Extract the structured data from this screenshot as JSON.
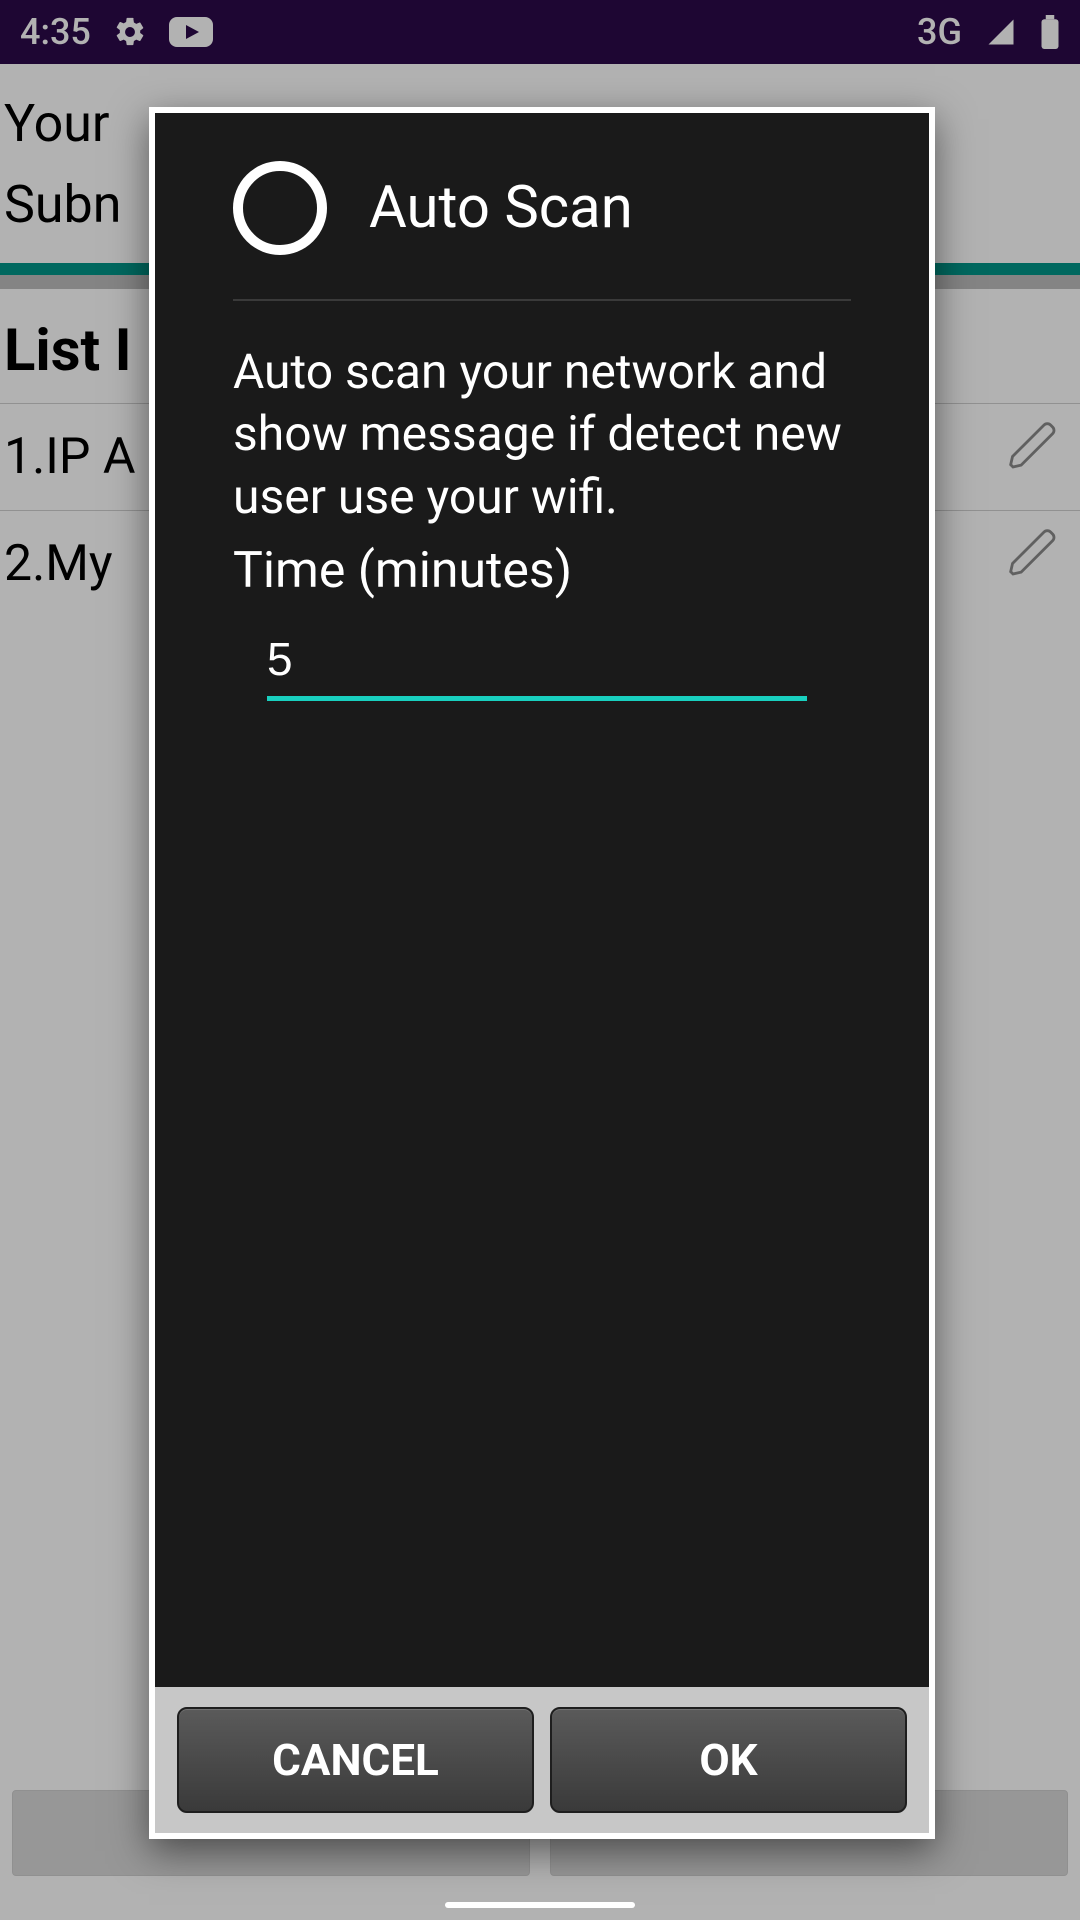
{
  "statusbar": {
    "time": "4:35",
    "network_label": "3G",
    "icons": {
      "settings": "settings-icon",
      "youtube": "youtube-icon",
      "signal": "signal-icon",
      "battery": "battery-icon"
    }
  },
  "background": {
    "ip_line_partial": "Your",
    "subnet_line_partial": "Subn",
    "section_title_partial": "List I",
    "rows": [
      {
        "label_partial": "1.IP A"
      },
      {
        "label_partial": "2.My"
      }
    ],
    "pencil_icon": "pencil-icon"
  },
  "dialog": {
    "title": "Auto Scan",
    "description": "Auto scan your network and show message if detect new user use your wifi.",
    "time_label": "Time (minutes)",
    "time_value": "5",
    "buttons": {
      "cancel": "CANCEL",
      "ok": "OK"
    },
    "colors": {
      "accent": "#19d0bf"
    },
    "ring_icon": "circle-outline-icon"
  }
}
